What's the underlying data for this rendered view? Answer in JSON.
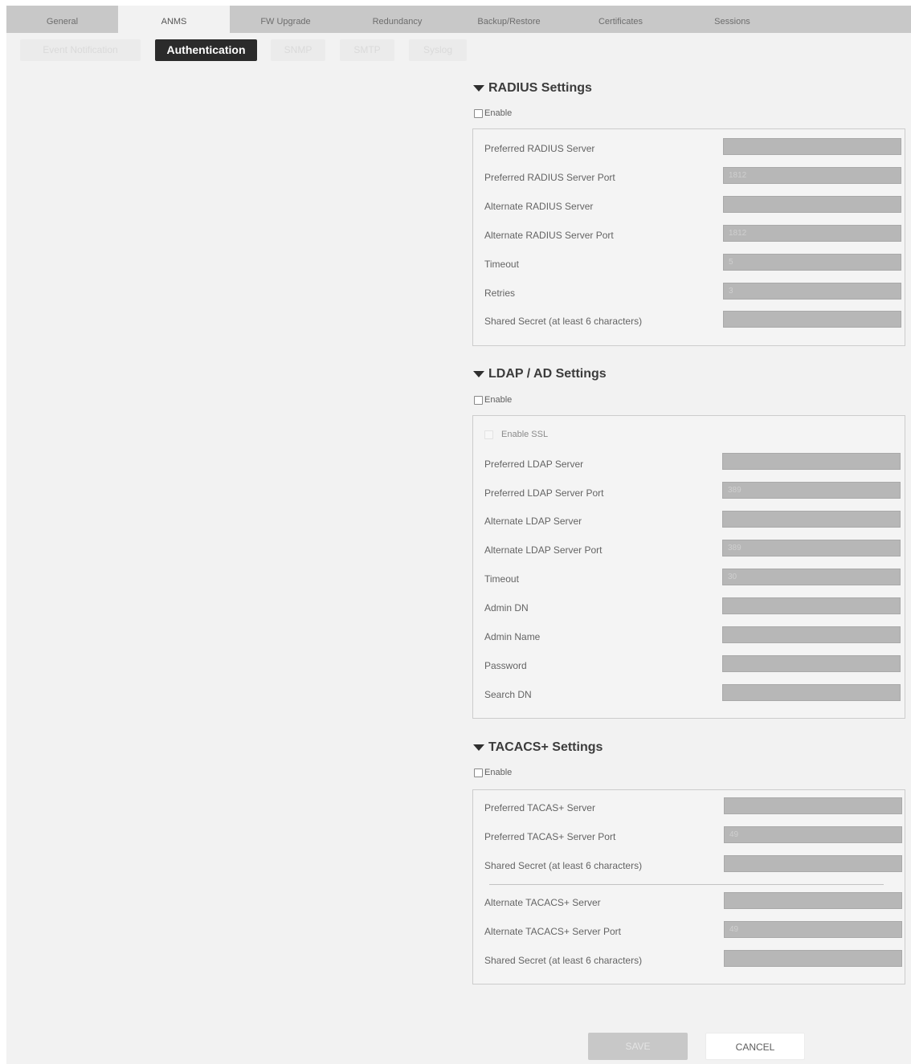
{
  "tabs": [
    {
      "label": "General"
    },
    {
      "label": "ANMS"
    },
    {
      "label": "FW Upgrade"
    },
    {
      "label": "Redundancy"
    },
    {
      "label": "Backup/Restore"
    },
    {
      "label": "Certificates"
    },
    {
      "label": "Sessions"
    }
  ],
  "active_tab": "ANMS",
  "subtabs": [
    {
      "label": "Event Notification"
    },
    {
      "label": "Authentication"
    },
    {
      "label": "SNMP"
    },
    {
      "label": "SMTP"
    },
    {
      "label": "Syslog"
    }
  ],
  "active_subtab": "Authentication",
  "radius": {
    "title": "RADIUS Settings",
    "enable_label": "Enable",
    "fields": [
      {
        "label": "Preferred RADIUS Server",
        "value": ""
      },
      {
        "label": "Preferred RADIUS Server Port",
        "value": "1812"
      },
      {
        "label": "Alternate RADIUS Server",
        "value": ""
      },
      {
        "label": "Alternate RADIUS Server Port",
        "value": "1812"
      },
      {
        "label": "Timeout",
        "value": "5"
      },
      {
        "label": "Retries",
        "value": "3"
      },
      {
        "label": "Shared Secret (at least 6 characters)",
        "value": ""
      }
    ]
  },
  "ldap": {
    "title": "LDAP / AD Settings",
    "enable_label": "Enable",
    "ssl_label": "Enable SSL",
    "fields": [
      {
        "label": "Preferred LDAP Server",
        "value": ""
      },
      {
        "label": "Preferred LDAP Server Port",
        "value": "389"
      },
      {
        "label": "Alternate LDAP Server",
        "value": ""
      },
      {
        "label": "Alternate LDAP Server Port",
        "value": "389"
      },
      {
        "label": "Timeout",
        "value": "30"
      },
      {
        "label": "Admin DN",
        "value": ""
      },
      {
        "label": "Admin Name",
        "value": ""
      },
      {
        "label": "Password",
        "value": ""
      },
      {
        "label": "Search DN",
        "value": ""
      }
    ]
  },
  "tacacs": {
    "title": "TACACS+ Settings",
    "enable_label": "Enable",
    "fields": [
      {
        "label": "Preferred TACAS+ Server",
        "value": ""
      },
      {
        "label": "Preferred TACAS+ Server Port",
        "value": "49"
      },
      {
        "label": "Shared Secret (at least 6 characters)",
        "value": ""
      },
      {
        "label": "Alternate TACACS+ Server",
        "value": ""
      },
      {
        "label": "Alternate TACACS+ Server Port",
        "value": "49"
      },
      {
        "label": "Shared Secret (at least 6 characters)",
        "value": ""
      }
    ]
  },
  "buttons": {
    "save": "SAVE",
    "cancel": "CANCEL"
  },
  "colors": {
    "active_subtab_bg": "#2b2b2b",
    "input_bg": "#b7b7b7",
    "tab_strip": "#c8c8c8",
    "page_bg": "#f2f2f2"
  }
}
